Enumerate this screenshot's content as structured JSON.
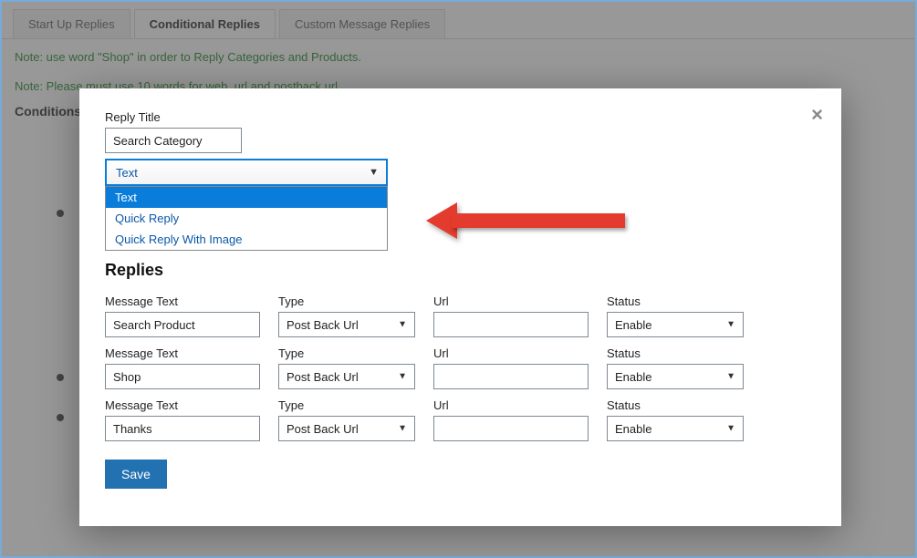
{
  "tabs": {
    "startup": "Start Up Replies",
    "conditional": "Conditional Replies",
    "custom": "Custom Message Replies"
  },
  "hint_line1": "Note: use word \"Shop\" in order to Reply Categories and Products.",
  "hint_line2": "Note: Please must use 10 words for web_url and postback url",
  "section_title": "Conditions",
  "modal": {
    "reply_title_label": "Reply Title",
    "reply_title_value": "Search Category",
    "type_select": {
      "selected": "Text",
      "options": [
        "Text",
        "Quick Reply",
        "Quick Reply With Image"
      ]
    },
    "replies_heading": "Replies",
    "column_labels": {
      "message": "Message Text",
      "type": "Type",
      "url": "Url",
      "status": "Status"
    },
    "rows": [
      {
        "message": "Search Product",
        "type": "Post Back Url",
        "url": "",
        "status": "Enable"
      },
      {
        "message": "Shop",
        "type": "Post Back Url",
        "url": "",
        "status": "Enable"
      },
      {
        "message": "Thanks",
        "type": "Post Back Url",
        "url": "",
        "status": "Enable"
      }
    ],
    "save_label": "Save"
  }
}
